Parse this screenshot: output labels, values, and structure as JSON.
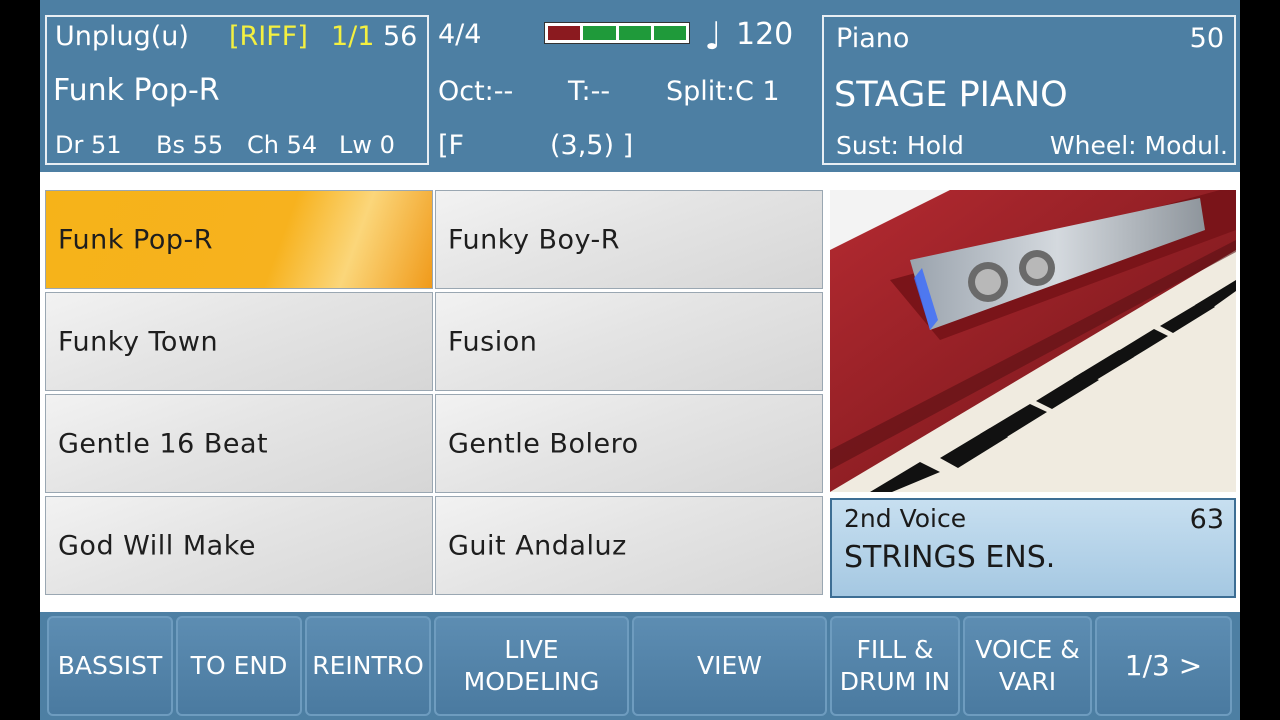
{
  "style_panel": {
    "mode": "Unplug(u)",
    "riff": "[RIFF]",
    "riff_pos": "1/1",
    "style_num": "56",
    "style_name": "Funk Pop-R",
    "mix": [
      "Dr 51",
      "Bs 55",
      "Ch 54",
      "Lw 0"
    ]
  },
  "center_panel": {
    "time_sig": "4/4",
    "tempo_icon": "quarter-note-icon",
    "tempo": "120",
    "octave": "Oct:--",
    "transpose": "T:--",
    "split": "Split:C 1",
    "chord_open": "[F",
    "chord_pos": "(3,5) ]",
    "meter_colors": [
      "#8b1a1f",
      "#1f9a3a",
      "#1f9a3a",
      "#1f9a3a"
    ]
  },
  "voice_panel": {
    "category": "Piano",
    "number": "50",
    "name": "STAGE PIANO",
    "sustain": "Sust: Hold",
    "wheel": "Wheel: Modul."
  },
  "styles": [
    {
      "label": "Funk Pop-R",
      "selected": true
    },
    {
      "label": "Funky Boy-R",
      "selected": false
    },
    {
      "label": "Funky Town",
      "selected": false
    },
    {
      "label": "Fusion",
      "selected": false
    },
    {
      "label": "Gentle 16 Beat",
      "selected": false
    },
    {
      "label": "Gentle Bolero",
      "selected": false
    },
    {
      "label": "God Will Make",
      "selected": false
    },
    {
      "label": "Guit Andaluz",
      "selected": false
    }
  ],
  "second_voice": {
    "title": "2nd Voice",
    "number": "63",
    "name": "STRINGS ENS."
  },
  "buttons": [
    "BASSIST",
    "TO END",
    "REINTRO",
    "LIVE\nMODELING",
    "VIEW",
    "FILL &\nDRUM IN",
    "VOICE &\nVARI",
    "1/3 >"
  ],
  "colors": {
    "accent": "#f6b319",
    "panel": "#4d7fa3",
    "highlight_text": "#f4f040"
  }
}
